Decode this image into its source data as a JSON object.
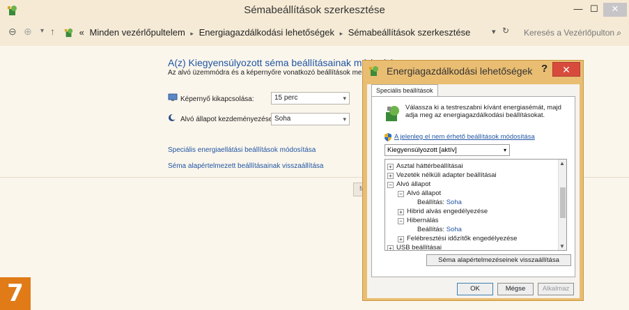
{
  "window": {
    "title": "Sémabeállítások szerkesztése",
    "controls": {
      "minimize": "—",
      "maximize": "☐",
      "close": "✕"
    }
  },
  "addressbar": {
    "back": "⊖",
    "forward": "⊕",
    "history": "▾",
    "up": "↑",
    "overflow": "«",
    "crumbs": [
      "Minden vezérlőpultelem",
      "Energiagazdálkodási lehetőségek",
      "Sémabeállítások szerkesztése"
    ],
    "separator": "▸",
    "dropdown": "▾",
    "refresh": "↻",
    "search_placeholder": "Keresés a Vezérlőpulton",
    "search_icon": "⌕"
  },
  "main": {
    "heading": "A(z) Kiegyensúlyozott séma beállításainak módosítása",
    "subtitle": "Az alvó üzemmódra és a képernyőre vonatkozó beállítások megadása.",
    "display_off_label": "Képernyő kikapcsolása:",
    "display_off_value": "15 perc",
    "sleep_label": "Alvó állapot kezdeményezése:",
    "sleep_value": "Soha",
    "advanced_link": "Speciális energiaellátási beállítások módosítása",
    "restore_link": "Séma alapértelmezett beállításainak visszaállítása",
    "hidden_button": "M"
  },
  "dialog": {
    "title": "Energiagazdálkodási lehetőségek",
    "help": "?",
    "close": "✕",
    "tab": "Speciális beállítások",
    "description": "Válassza ki a testreszabni kívánt energiasémát, majd adja meg az energiagazdálkodási beállításokat.",
    "unavailable_link": "A jelenleg el nem érhető beállítások módosítása",
    "plan": "Kiegyensúlyozott [aktív]",
    "tree": [
      {
        "exp": "+",
        "label": "Asztal háttérbeállításai",
        "value": ""
      },
      {
        "exp": "+",
        "label": "Vezeték nélküli adapter beállításai",
        "value": ""
      },
      {
        "exp": "−",
        "label": "Alvó állapot",
        "value": ""
      },
      {
        "exp": "−",
        "label": "Alvó állapot",
        "value": ""
      },
      {
        "exp": "",
        "label": "Beállítás:",
        "value": "Soha"
      },
      {
        "exp": "+",
        "label": "Hibrid alvás engedélyezése",
        "value": ""
      },
      {
        "exp": "−",
        "label": "Hibernálás",
        "value": ""
      },
      {
        "exp": "",
        "label": "Beállítás:",
        "value": "Soha"
      },
      {
        "exp": "+",
        "label": "Felébresztési időzítők engedélyezése",
        "value": ""
      },
      {
        "exp": "+",
        "label": "USB beállításai",
        "value": ""
      }
    ],
    "restore_button": "Séma alapértelmezéseinek visszaállítása",
    "ok": "OK",
    "cancel": "Mégse",
    "apply": "Alkalmaz"
  },
  "badge": "7",
  "colors": {
    "accent": "#1f55a3",
    "badge": "#e07b18",
    "dialog_frame": "#e9bd72",
    "close_red": "#d84b3c"
  }
}
